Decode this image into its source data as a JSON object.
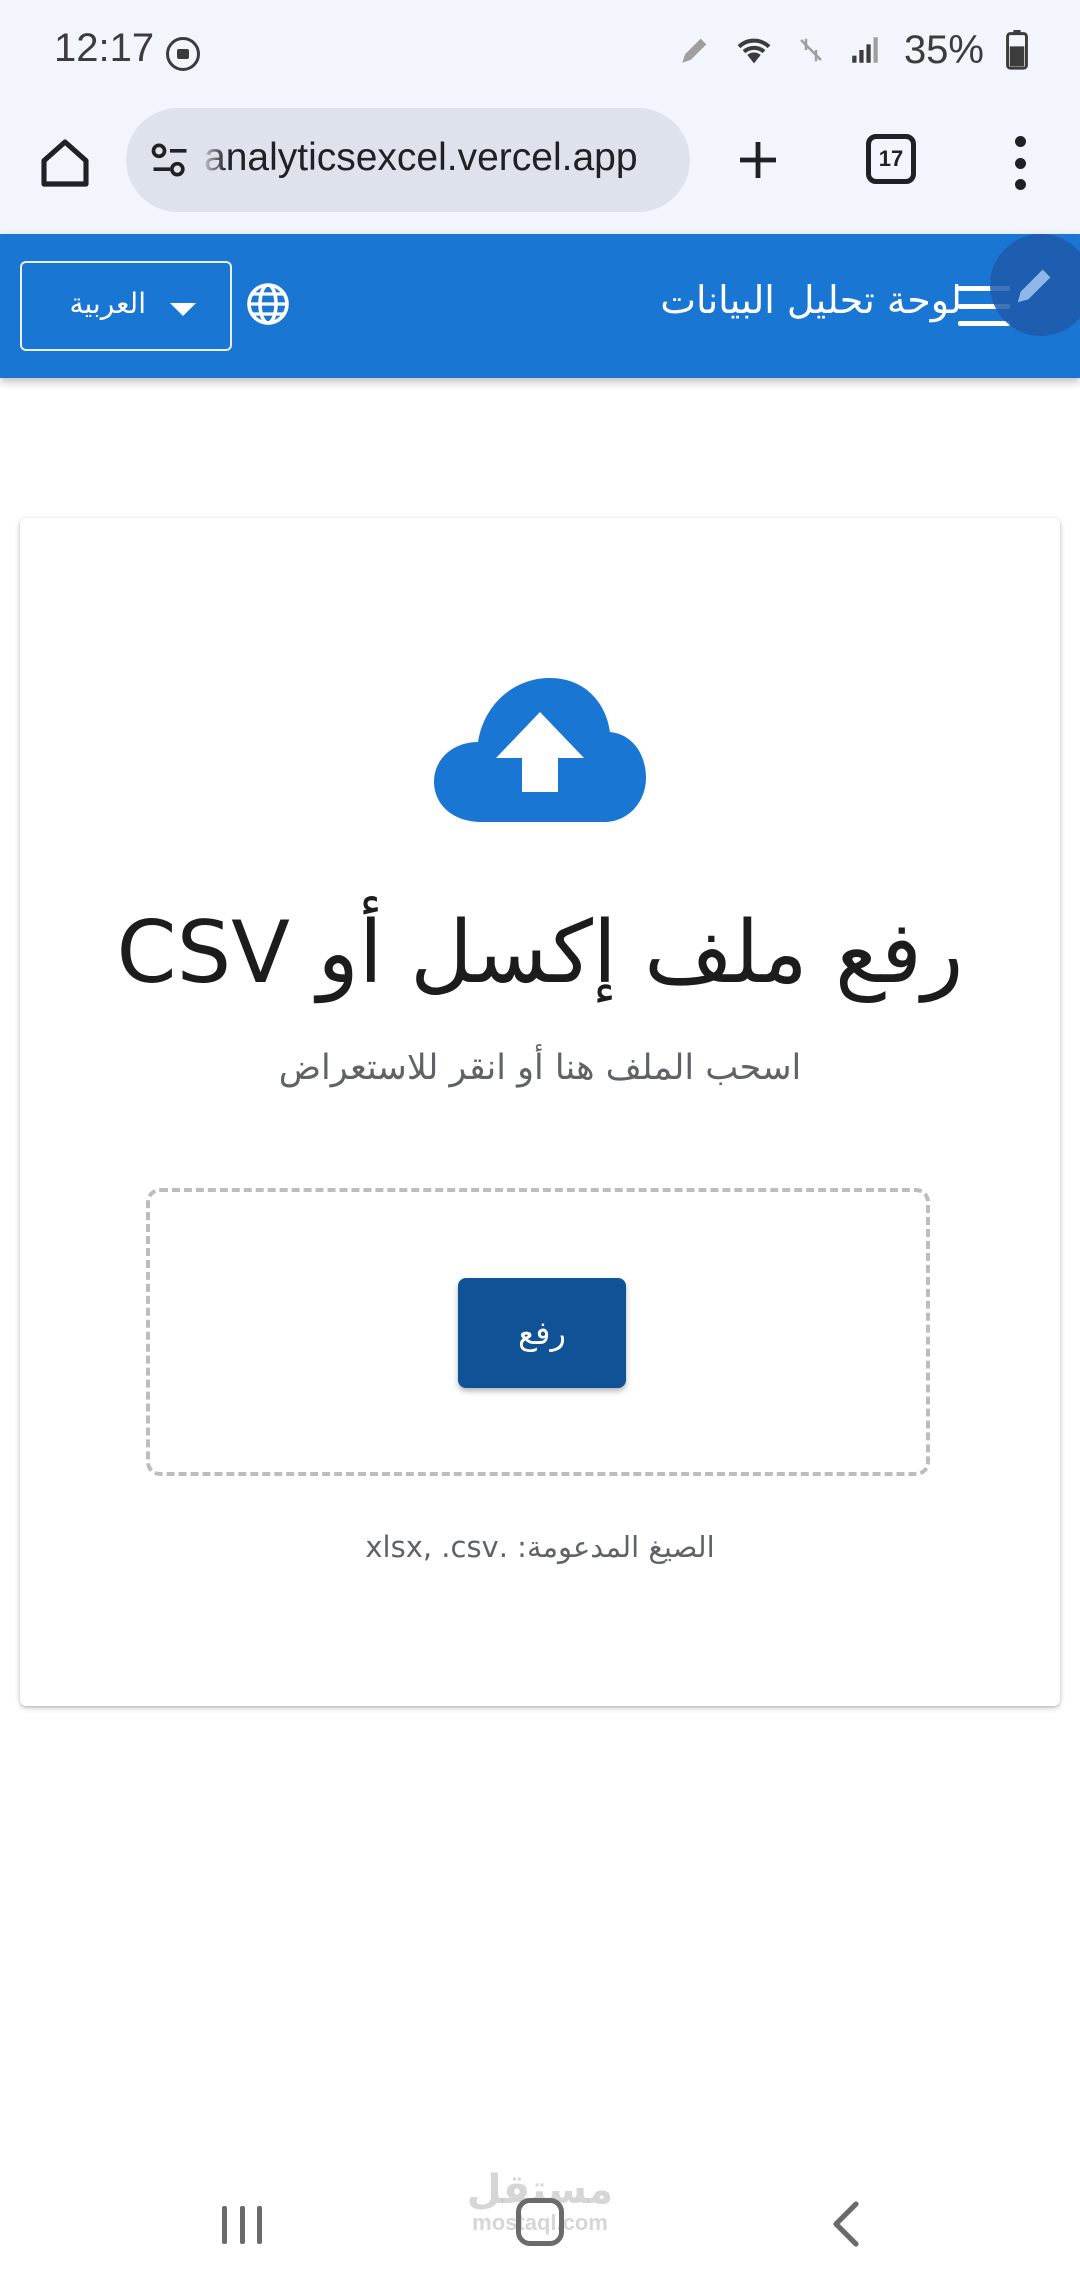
{
  "status_bar": {
    "time": "12:17",
    "battery": "35%",
    "icons": [
      "screen-record-icon",
      "pen-icon",
      "wifi-icon",
      "data-off-icon",
      "signal-icon",
      "battery-icon"
    ]
  },
  "browser": {
    "url": "analyticsexcel.vercel.app",
    "tab_count": "17",
    "icons": [
      "home-icon",
      "site-settings-icon",
      "plus-icon",
      "more-vert-icon"
    ]
  },
  "app_bar": {
    "title": "لوحة تحليل البيانات",
    "language_selected": "العربية",
    "color": "#1976d2",
    "icons": [
      "globe-icon",
      "menu-icon",
      "edit-icon"
    ]
  },
  "upload_card": {
    "title": "رفع ملف إكسل أو CSV",
    "subtitle": "اسحب الملف هنا أو انقر للاستعراض",
    "button_label": "رفع",
    "supported_formats": "الصيغ المدعومة: .xlsx, .csv",
    "button_color": "#0f5396",
    "icons": [
      "cloud-upload-icon"
    ]
  },
  "nav_bar": {
    "icons": [
      "recent-apps-icon",
      "home-nav-icon",
      "back-icon"
    ]
  },
  "watermark": {
    "arabic": "مستقل",
    "latin": "mostaql.com"
  }
}
